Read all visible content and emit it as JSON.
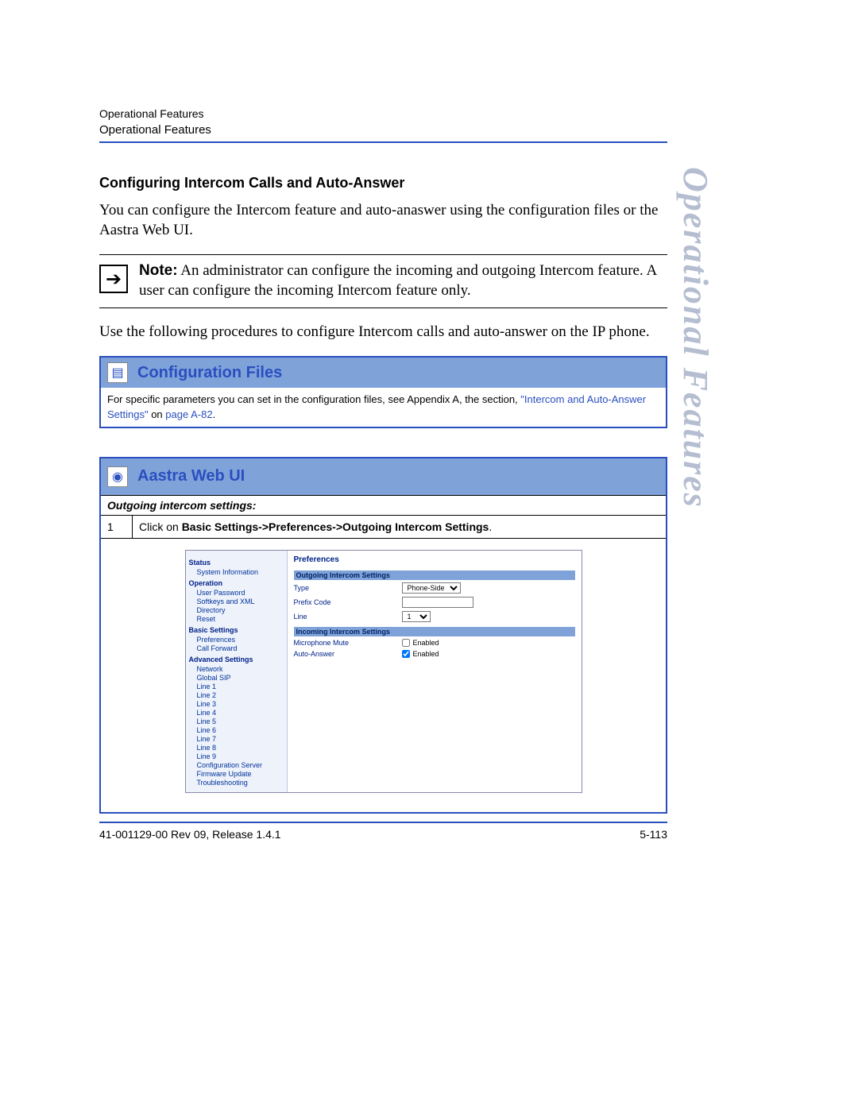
{
  "header": {
    "small": "Operational Features",
    "main": "Operational Features"
  },
  "side_label": "Operational Features",
  "section": {
    "title": "Configuring Intercom Calls and Auto-Answer",
    "intro": "You can configure the Intercom feature and auto-anaswer using the configuration files or the Aastra Web UI.",
    "note_label": "Note:",
    "note_text": " An administrator can configure the incoming and outgoing Intercom feature. A user can configure the incoming Intercom feature only.",
    "after_note": "Use the following procedures to configure Intercom calls and auto-answer on the IP phone."
  },
  "config_panel": {
    "title": "Configuration Files",
    "body_pre": "For specific parameters you can set in the configuration files, see Appendix A, the section, ",
    "link1": "\"Intercom and Auto-Answer Settings\"",
    "body_mid": " on ",
    "link2": "page A-82",
    "body_post": "."
  },
  "webui_panel": {
    "title": "Aastra Web UI",
    "subtitle": "Outgoing intercom settings:",
    "step_num": "1",
    "step_pre": "Click on ",
    "step_bold": "Basic Settings->Preferences->Outgoing Intercom Settings",
    "step_post": "."
  },
  "app": {
    "sidebar": {
      "cat1": "Status",
      "cat1_items": [
        "System Information"
      ],
      "cat2": "Operation",
      "cat2_items": [
        "User Password",
        "Softkeys and XML",
        "Directory",
        "Reset"
      ],
      "cat3": "Basic Settings",
      "cat3_items": [
        "Preferences",
        "Call Forward"
      ],
      "cat4": "Advanced Settings",
      "cat4_items": [
        "Network",
        "Global SIP",
        "Line 1",
        "Line 2",
        "Line 3",
        "Line 4",
        "Line 5",
        "Line 6",
        "Line 7",
        "Line 8",
        "Line 9",
        "Configuration Server",
        "Firmware Update",
        "Troubleshooting"
      ]
    },
    "main": {
      "heading": "Preferences",
      "section1": "Outgoing Intercom Settings",
      "row_type_label": "Type",
      "row_type_value": "Phone-Side",
      "row_prefix_label": "Prefix Code",
      "row_prefix_value": "",
      "row_line_label": "Line",
      "row_line_value": "1",
      "section2": "Incoming Intercom Settings",
      "row_mic_label": "Microphone Mute",
      "row_mic_enabled": "Enabled",
      "row_auto_label": "Auto-Answer",
      "row_auto_enabled": "Enabled"
    }
  },
  "footer": {
    "left": "41-001129-00 Rev 09, Release 1.4.1",
    "right": "5-113"
  }
}
